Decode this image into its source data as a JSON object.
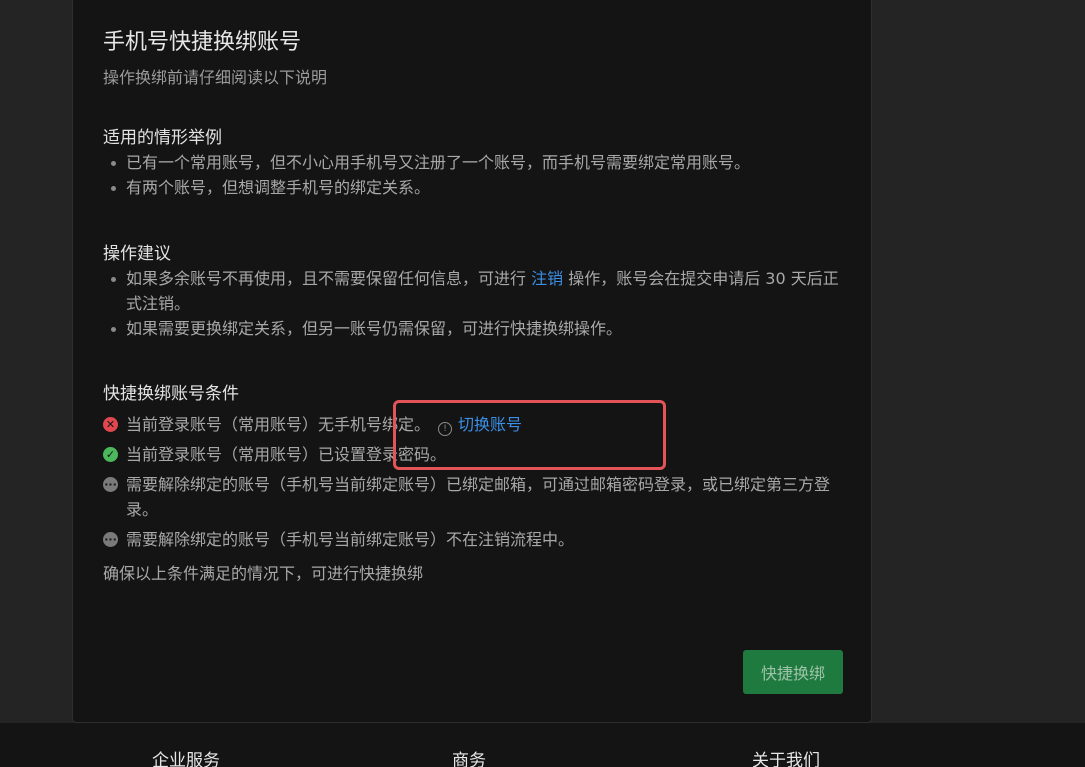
{
  "dialog": {
    "title": "手机号快捷换绑账号",
    "subtitle": "操作换绑前请仔细阅读以下说明",
    "cases": {
      "title": "适用的情形举例",
      "items": [
        "已有一个常用账号，但不小心用手机号又注册了一个账号，而手机号需要绑定常用账号。",
        "有两个账号，但想调整手机号的绑定关系。"
      ]
    },
    "advice": {
      "title": "操作建议",
      "item1_before": "如果多余账号不再使用，且不需要保留任何信息，可进行 ",
      "item1_link": "注销",
      "item1_after": " 操作，账号会在提交申请后 30 天后正式注销。",
      "item2": "如果需要更换绑定关系，但另一账号仍需保留，可进行快捷换绑操作。"
    },
    "conditions": {
      "title": "快捷换绑账号条件",
      "items": [
        {
          "status": "fail",
          "icon": "close-circle-icon",
          "text": "当前登录账号（常用账号）无手机号绑定。",
          "link": "切换账号"
        },
        {
          "status": "ok",
          "icon": "check-circle-icon",
          "text": "当前登录账号（常用账号）已设置登录密码。"
        },
        {
          "status": "pending",
          "icon": "more-circle-icon",
          "text": "需要解除绑定的账号（手机号当前绑定账号）已绑定邮箱，可通过邮箱密码登录，或已绑定第三方登录。"
        },
        {
          "status": "pending",
          "icon": "more-circle-icon",
          "text": "需要解除绑定的账号（手机号当前绑定账号）不在注销流程中。"
        }
      ],
      "summary": "确保以上条件满足的情况下，可进行快捷换绑"
    },
    "primary_button": "快捷换绑",
    "colors": {
      "link": "#3c8fe6",
      "fail": "#e0474f",
      "ok": "#4cb85c",
      "button": "#1f7a3f",
      "highlight": "#e25458"
    }
  },
  "footer": {
    "columns": [
      "企业服务",
      "商务",
      "关于我们"
    ]
  }
}
